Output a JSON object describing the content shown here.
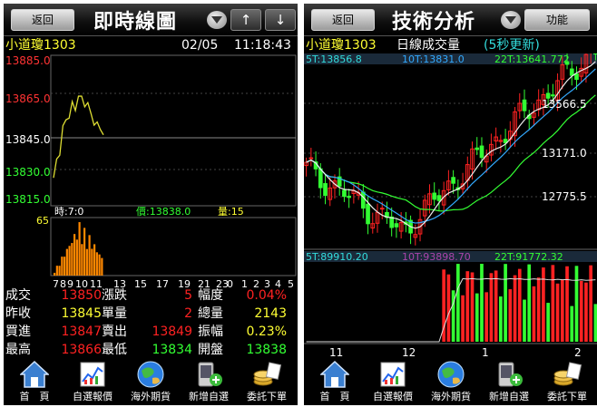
{
  "left": {
    "header": {
      "back_label": "返回",
      "title": "即時線圖",
      "up_label": "↑",
      "down_label": "↓"
    },
    "info": {
      "name": "小道瓊1303",
      "date": "02/05",
      "time": "11:18:43"
    },
    "price_axis": [
      "13885.0",
      "13865.0",
      "13845.0",
      "13830.0",
      "13815.0"
    ],
    "price_axis_colors": [
      "#ff3333",
      "#ff3333",
      "#ffffff",
      "#33ff33",
      "#33ff33"
    ],
    "cursor_info": {
      "time": "時:7:0",
      "price": "價:13838.0",
      "volume": "量:15"
    },
    "volume_max_label": "65",
    "time_axis": [
      "7",
      "8",
      "9",
      "10",
      "11",
      "13",
      "15",
      "17",
      "19",
      "21",
      "23",
      "0",
      "1",
      "2",
      "3",
      "4",
      "5"
    ],
    "stats": [
      {
        "label": "成交",
        "value": "13850",
        "color": "red"
      },
      {
        "label": "漲跌",
        "value": "5",
        "color": "red"
      },
      {
        "label": "幅度",
        "value": "0.04%",
        "color": "red"
      },
      {
        "label": "昨收",
        "value": "13845",
        "color": "yel"
      },
      {
        "label": "單量",
        "value": "2",
        "color": "red"
      },
      {
        "label": "總量",
        "value": "2143",
        "color": "yel"
      },
      {
        "label": "買進",
        "value": "13847",
        "color": "red"
      },
      {
        "label": "賣出",
        "value": "13849",
        "color": "red"
      },
      {
        "label": "振幅",
        "value": "0.23%",
        "color": "yel"
      },
      {
        "label": "最高",
        "value": "13866",
        "color": "red"
      },
      {
        "label": "最低",
        "value": "13834",
        "color": "grn"
      },
      {
        "label": "開盤",
        "value": "13838",
        "color": "grn"
      }
    ]
  },
  "right": {
    "header": {
      "back_label": "返回",
      "title": "技術分析",
      "func_label": "功能"
    },
    "info": {
      "name": "小道瓊1303",
      "kind": "日線成交量",
      "update": "(5秒更新)"
    },
    "ma_price": {
      "ma5": "5T:13856.8",
      "ma10": "10T:13831.0",
      "ma22": "22T:13641.772"
    },
    "price_axis": [
      "13566.5",
      "13171.0",
      "12775.5"
    ],
    "ma_volume": {
      "ma5": "5T:89910.20",
      "ma10": "10T:93898.70",
      "ma22": "22T:91772.32"
    },
    "date_axis": [
      "11",
      "12",
      "1",
      "2"
    ]
  },
  "nav": [
    {
      "label": "首　頁",
      "icon": "home-icon"
    },
    {
      "label": "自選報價",
      "icon": "quote-chart-icon"
    },
    {
      "label": "海外期貨",
      "icon": "globe-icon"
    },
    {
      "label": "新增自選",
      "icon": "add-phone-icon"
    },
    {
      "label": "委託下單",
      "icon": "coins-icon"
    }
  ],
  "colors": {
    "up": "#ff2222",
    "down": "#33ff33",
    "flat": "#ffffff",
    "grid": "#666666",
    "volume": "#ff8800",
    "price_line": "#dddd33"
  },
  "chart_data": [
    {
      "type": "line",
      "title": "即時線圖",
      "x": [
        "7",
        "8",
        "9",
        "10",
        "11"
      ],
      "series": [
        {
          "values": [
            13828,
            13855,
            13866,
            13858,
            13848
          ]
        }
      ],
      "ylim": [
        13815,
        13885
      ],
      "reference": 13845
    },
    {
      "type": "bar",
      "x": [
        "7",
        "8",
        "9",
        "10",
        "11"
      ],
      "series": [
        {
          "values": [
            6,
            35,
            65,
            45,
            18
          ]
        }
      ],
      "ylim": [
        0,
        65
      ]
    },
    {
      "type": "line",
      "title": "日線成交量",
      "x": [
        "11",
        "12",
        "1",
        "2"
      ],
      "series": [
        {
          "name": "5T",
          "values": [
            13100,
            12700,
            13300,
            13857
          ]
        },
        {
          "name": "10T",
          "values": [
            13050,
            12780,
            13200,
            13831
          ]
        },
        {
          "name": "22T",
          "values": [
            12900,
            12850,
            13050,
            13642
          ]
        }
      ],
      "ylim": [
        12600,
        13750
      ]
    },
    {
      "type": "bar",
      "x": [
        "11",
        "12",
        "1",
        "2"
      ],
      "series": [
        {
          "name": "5T",
          "values": [
            0,
            0,
            95000,
            89910
          ]
        },
        {
          "name": "10T",
          "values": [
            0,
            0,
            92000,
            93899
          ]
        },
        {
          "name": "22T",
          "values": [
            0,
            0,
            88000,
            91772
          ]
        }
      ]
    }
  ]
}
